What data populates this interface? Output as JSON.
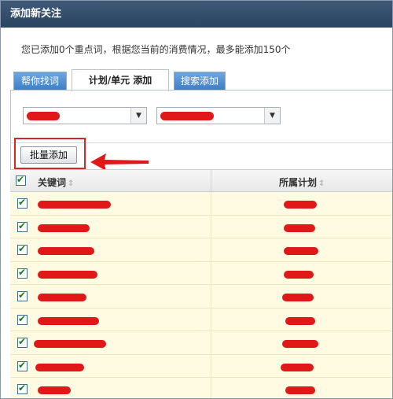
{
  "dialog": {
    "title": "添加新关注",
    "info_text": "您已添加0个重点词，根据您当前的消费情况，最多能添加150个"
  },
  "tabs": [
    {
      "label": "帮你找词"
    },
    {
      "label": "计划/单元 添加"
    },
    {
      "label": "搜索添加"
    }
  ],
  "toolbar": {
    "batch_add_label": "批量添加"
  },
  "table": {
    "columns": [
      {
        "label": "关键词"
      },
      {
        "label": "所属计划"
      }
    ],
    "rows": [
      {
        "checked": true
      },
      {
        "checked": true
      },
      {
        "checked": true
      },
      {
        "checked": true
      },
      {
        "checked": true
      },
      {
        "checked": true
      },
      {
        "checked": true
      },
      {
        "checked": true
      },
      {
        "checked": true
      }
    ]
  },
  "colors": {
    "titlebar": "#2f4a68",
    "tab_blue": "#4a8ad0",
    "row_highlight": "#fffbe3",
    "annotation_red": "#d8242a"
  }
}
